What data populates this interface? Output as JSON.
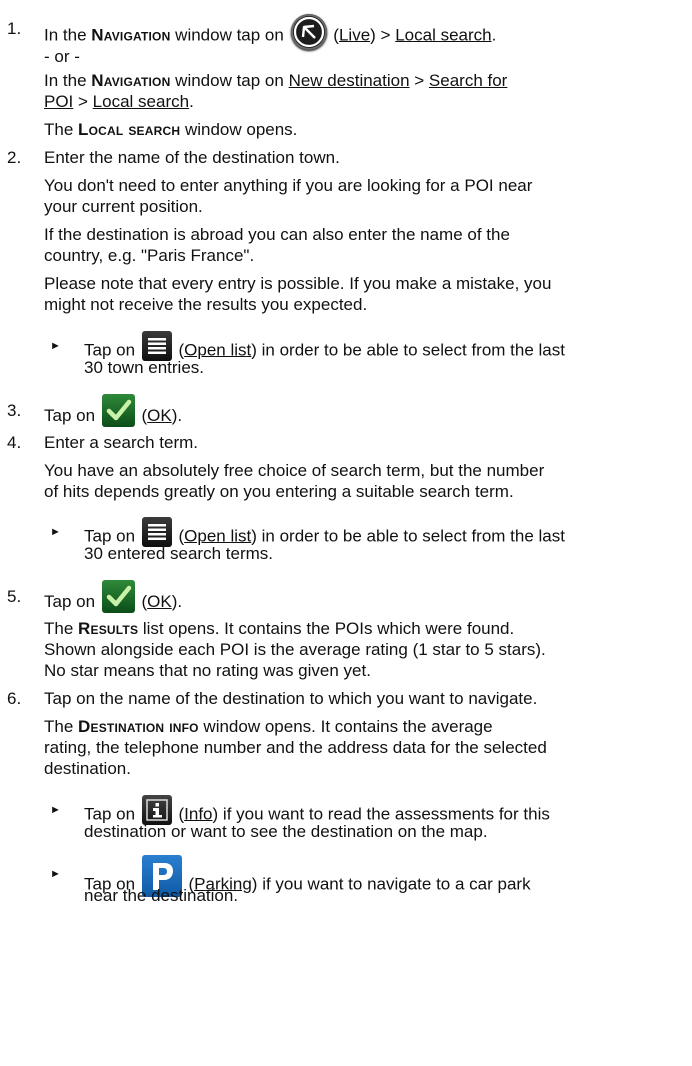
{
  "steps": {
    "s1": {
      "num": "1.",
      "a_pre": "In the ",
      "a_win": "Navigation",
      "a_mid": " window tap on ",
      "a_link1": "Live",
      "a_sep": " > ",
      "a_link2": "Local search",
      "or": "- or -",
      "b_pre": "In the ",
      "b_win": "Navigation",
      "b_mid": " window tap on ",
      "b_link1": "New destination",
      "b_link2a": "Search for",
      "b_link2b": "POI",
      "b_link3": "Local search",
      "c_pre": "The ",
      "c_win": "Local search",
      "c_post": " window opens."
    },
    "s2": {
      "num": "2.",
      "line1": "Enter the name of the destination town.",
      "p1l1": "You don't need to enter anything if you are looking for a POI near",
      "p1l2": "your current position.",
      "p2l1": "If the destination is abroad you can also enter the name of the",
      "p2l2": "country, e.g. \"Paris France\".",
      "p3l1": "Please note that every entry is possible. If you make a mistake, you",
      "p3l2": "might not receive the results you expected.",
      "b_pre": "Tap on ",
      "b_link": "Open list",
      "b_post1": " in order to be able to select from the last",
      "b_post2": "30 town entries."
    },
    "s3": {
      "num": "3.",
      "pre": "Tap on ",
      "link": "OK",
      "post": "."
    },
    "s4": {
      "num": "4.",
      "line1": "Enter a search term.",
      "p1l1": "You have an absolutely free choice of search term, but the number",
      "p1l2": "of hits depends greatly on you entering a suitable search term.",
      "b_pre": "Tap on ",
      "b_link": "Open list",
      "b_post1": " in order to be able to select from the last",
      "b_post2": "30 entered search terms."
    },
    "s5": {
      "num": "5.",
      "pre": "Tap on ",
      "link": "OK",
      "post": ".",
      "r_pre": "The ",
      "r_win": "Results",
      "r_l1": " list opens. It contains the POIs which were found.",
      "r_l2": "Shown alongside each POI is the average rating (1 star to 5 stars).",
      "r_l3": "No star means that no rating was given yet."
    },
    "s6": {
      "num": "6.",
      "line1": "Tap on the name of the destination to which you want to navigate.",
      "d_pre": "The ",
      "d_win": "Destination info",
      "d_l1": " window opens. It contains the average",
      "d_l2": "rating, the telephone number and the address data for the selected",
      "d_l3": "destination.",
      "b1_pre": "Tap on ",
      "b1_link": "Info",
      "b1_post1": " if you want to read the assessments for this",
      "b1_post2": "destination or want to see the destination on the map.",
      "b2_pre": "Tap on ",
      "b2_link": "Parking",
      "b2_post1": " if you want to navigate to a car park",
      "b2_post2": "near the destination."
    }
  },
  "icons": {
    "live": "live-icon",
    "list": "open-list-icon",
    "ok": "ok-checkmark-icon",
    "info": "info-icon",
    "parking": "parking-icon",
    "bullet": "►"
  },
  "colors": {
    "ok_green": "#2f8a3a",
    "parking_blue": "#1f6fc2"
  }
}
